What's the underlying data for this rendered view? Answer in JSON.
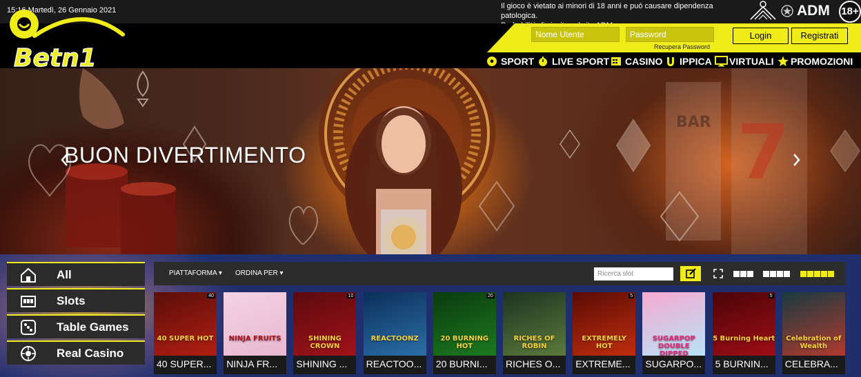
{
  "topbar": {
    "datetime": "15:16 Martedì, 26 Gennaio 2021",
    "legal_line1": "Il gioco è vietato ai minori di 18 anni e può causare dipendenza patologica.",
    "legal_line2": "Probabilità di vincita sul sito ADM.",
    "adm": "ADM",
    "age": "18+"
  },
  "brand": {
    "logo_text": "Betn1"
  },
  "login": {
    "username_placeholder": "Nome Utente",
    "password_placeholder": "Password",
    "recover": "Recupera Password",
    "login_label": "Login",
    "register_label": "Registrati"
  },
  "nav": [
    "SPORT",
    "LIVE SPORT",
    "CASINO",
    "IPPICA",
    "VIRTUALI",
    "PROMOZIONI"
  ],
  "hero": {
    "title": "BUON DIVERTIMENTO"
  },
  "categories": [
    "All",
    "Slots",
    "Table Games",
    "Real Casino"
  ],
  "toolbar": {
    "platform": "PIATTAFORMA",
    "sort": "ORDINA PER",
    "search_placeholder": "Ricerca slot"
  },
  "games": [
    {
      "name": "40 SUPER...",
      "art": "40 SUPER HOT",
      "tag": "40",
      "colors": [
        "#5a0e0a",
        "#b21e12"
      ]
    },
    {
      "name": "NINJA FR...",
      "art": "NINJA FRUITS",
      "tag": "",
      "colors": [
        "#f3d3e4",
        "#e8b7cf"
      ]
    },
    {
      "name": "SHINING ...",
      "art": "SHINING CROWN",
      "tag": "10",
      "colors": [
        "#5b0a0e",
        "#a1121a"
      ]
    },
    {
      "name": "REACTOO...",
      "art": "REACTOONZ",
      "tag": "",
      "colors": [
        "#0c2f5a",
        "#2a6fa8"
      ]
    },
    {
      "name": "20 BURNI...",
      "art": "20 BURNING HOT",
      "tag": "20",
      "colors": [
        "#0a3a0e",
        "#1d7a20"
      ]
    },
    {
      "name": "RICHES O...",
      "art": "RICHES OF ROBIN",
      "tag": "",
      "colors": [
        "#1d3321",
        "#5c7a3b"
      ]
    },
    {
      "name": "EXTREME...",
      "art": "EXTREMELY HOT",
      "tag": "5",
      "colors": [
        "#5a0c06",
        "#c12d0d"
      ]
    },
    {
      "name": "SUGARPO...",
      "art": "SUGARPOP DOUBLE DIPPED",
      "tag": "",
      "colors": [
        "#f7a9d0",
        "#b7e3f7"
      ]
    },
    {
      "name": "5 BURNIN...",
      "art": "5 Burning Heart",
      "tag": "5",
      "colors": [
        "#4a0508",
        "#a00d16"
      ]
    },
    {
      "name": "CELEBRA...",
      "art": "Celebration of Wealth",
      "tag": "",
      "colors": [
        "#1a3a40",
        "#b03a2e"
      ]
    }
  ],
  "colors": {
    "accent": "#f0ec1a",
    "dark": "#2b2b2b"
  }
}
